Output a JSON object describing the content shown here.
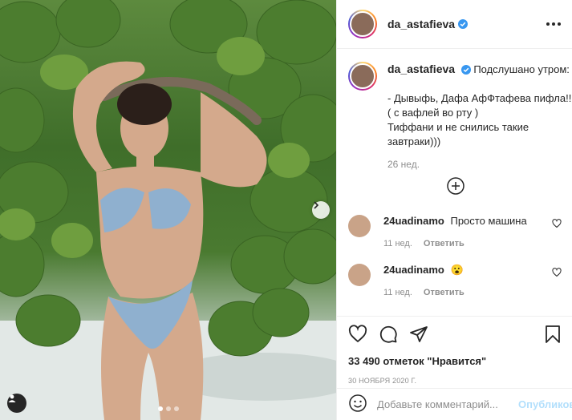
{
  "post": {
    "username": "da_astafieva",
    "verified": true,
    "caption_lines": [
      "Подслушано утром:",
      "",
      "- Дывыфь, Дафа АфФтафева пифла!!!",
      "( с вафлей во рту )",
      "Тиффани и не снились такие",
      "завтраки)))"
    ],
    "caption_age": "26 нед.",
    "carousel": {
      "total": 3,
      "active": 0
    }
  },
  "comments": [
    {
      "username": "24uadinamo",
      "text": "Просто машина",
      "age": "11 нед.",
      "reply_label": "Ответить"
    },
    {
      "username": "24uadinamo",
      "text": "😮",
      "age": "11 нед.",
      "reply_label": "Ответить"
    }
  ],
  "stats": {
    "likes_count": "33 490",
    "likes_label": "отметок \"Нравится\"",
    "date": "30 НОЯБРЯ 2020 Г."
  },
  "composer": {
    "placeholder": "Добавьте комментарий...",
    "publish_label": "Опубликовать"
  },
  "colors": {
    "text": "#262626",
    "muted": "#8e8e8e",
    "verified": "#3897f0",
    "publish_disabled": "#b2dffc"
  },
  "icons": {
    "verified": "verified-badge-icon",
    "more": "more-options-icon",
    "add": "plus-circle-icon",
    "heart": "heart-icon",
    "comment": "comment-icon",
    "share": "paper-plane-icon",
    "save": "bookmark-icon",
    "emoji": "emoji-icon",
    "next": "chevron-right-icon",
    "tag": "user-tag-icon"
  }
}
